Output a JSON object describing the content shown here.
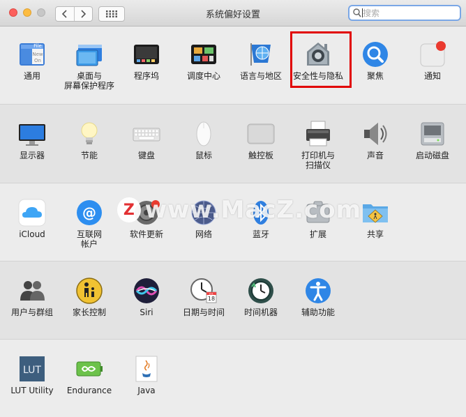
{
  "window": {
    "title": "系统偏好设置"
  },
  "search": {
    "placeholder": "搜索",
    "value": ""
  },
  "toolbar": {
    "back_icon": "chevron-left-icon",
    "forward_icon": "chevron-right-icon",
    "grid_icon": "grid-icon"
  },
  "rows": {
    "row1": [
      {
        "label": "通用",
        "icon": "general-icon"
      },
      {
        "label": "桌面与\n屏幕保护程序",
        "icon": "desktop-icon"
      },
      {
        "label": "程序坞",
        "icon": "dock-icon"
      },
      {
        "label": "调度中心",
        "icon": "mission-control-icon"
      },
      {
        "label": "语言与地区",
        "icon": "language-region-icon"
      },
      {
        "label": "安全性与隐私",
        "icon": "security-privacy-icon"
      },
      {
        "label": "聚焦",
        "icon": "spotlight-icon"
      },
      {
        "label": "通知",
        "icon": "notifications-icon"
      }
    ],
    "row2": [
      {
        "label": "显示器",
        "icon": "displays-icon"
      },
      {
        "label": "节能",
        "icon": "energy-saver-icon"
      },
      {
        "label": "键盘",
        "icon": "keyboard-icon"
      },
      {
        "label": "鼠标",
        "icon": "mouse-icon"
      },
      {
        "label": "触控板",
        "icon": "trackpad-icon"
      },
      {
        "label": "打印机与\n扫描仪",
        "icon": "printer-icon"
      },
      {
        "label": "声音",
        "icon": "sound-icon"
      },
      {
        "label": "启动磁盘",
        "icon": "startup-disk-icon"
      }
    ],
    "row3": [
      {
        "label": "iCloud",
        "icon": "icloud-icon"
      },
      {
        "label": "互联网\n帐户",
        "icon": "internet-accounts-icon"
      },
      {
        "label": "软件更新",
        "icon": "software-update-icon"
      },
      {
        "label": "网络",
        "icon": "network-icon"
      },
      {
        "label": "蓝牙",
        "icon": "bluetooth-icon"
      },
      {
        "label": "扩展",
        "icon": "extensions-icon"
      },
      {
        "label": "共享",
        "icon": "sharing-icon"
      }
    ],
    "row4": [
      {
        "label": "用户与群组",
        "icon": "users-groups-icon"
      },
      {
        "label": "家长控制",
        "icon": "parental-controls-icon"
      },
      {
        "label": "Siri",
        "icon": "siri-icon"
      },
      {
        "label": "日期与时间",
        "icon": "date-time-icon"
      },
      {
        "label": "时间机器",
        "icon": "time-machine-icon"
      },
      {
        "label": "辅助功能",
        "icon": "accessibility-icon"
      }
    ],
    "row5": [
      {
        "label": "LUT Utility",
        "icon": "lut-utility-icon"
      },
      {
        "label": "Endurance",
        "icon": "endurance-icon"
      },
      {
        "label": "Java",
        "icon": "java-icon"
      }
    ]
  },
  "icon_text": {
    "file": "File",
    "new": "New",
    "one": "On",
    "lut": "LUT",
    "date": "18",
    "month": "JUL"
  },
  "watermark": {
    "logo": "Z",
    "text": "www.MacZ.com"
  },
  "colors": {
    "highlight": "#e10000",
    "accent": "#3b82f6"
  }
}
